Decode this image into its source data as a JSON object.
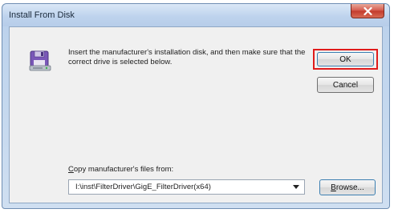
{
  "window": {
    "title": "Install From Disk",
    "close_label": "X"
  },
  "dialog": {
    "message": "Insert the manufacturer's installation disk, and then make sure that the correct drive is selected below.",
    "ok_label": "OK",
    "cancel_label": "Cancel",
    "copy_label_first": "C",
    "copy_label_rest": "opy manufacturer's files from:",
    "path_value": "I:\\inst\\FilterDriver\\GigE_FilterDriver(x64)",
    "browse_label_first": "B",
    "browse_label_rest": "rowse..."
  },
  "colors": {
    "highlight": "#e01b1b",
    "close_button": "#c23a2c",
    "titlebar": "#bed3ed"
  },
  "icons": {
    "dialog_icon": "floppy-disk-install-icon",
    "close": "close-icon",
    "dropdown": "chevron-down-icon"
  }
}
